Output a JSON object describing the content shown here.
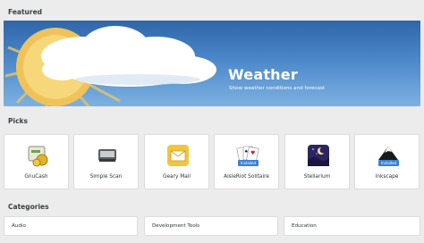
{
  "sections": {
    "featured": "Featured",
    "picks": "Picks",
    "categories": "Categories"
  },
  "featured": {
    "title": "Weather",
    "subtitle": "Show weather conditions and forecast"
  },
  "picks": [
    {
      "label": "GnuCash",
      "icon": "gnucash-icon",
      "installed": false
    },
    {
      "label": "Simple Scan",
      "icon": "scanner-icon",
      "installed": false
    },
    {
      "label": "Geary Mail",
      "icon": "mail-icon",
      "installed": false
    },
    {
      "label": "AisleRiot Solitaire",
      "icon": "cards-icon",
      "installed": true,
      "badge": "Installed"
    },
    {
      "label": "Stellarium",
      "icon": "stellarium-icon",
      "installed": false
    },
    {
      "label": "Inkscape",
      "icon": "inkscape-icon",
      "installed": true,
      "badge": "Installed"
    }
  ],
  "categories": [
    "Audio",
    "Development Tools",
    "Education"
  ]
}
